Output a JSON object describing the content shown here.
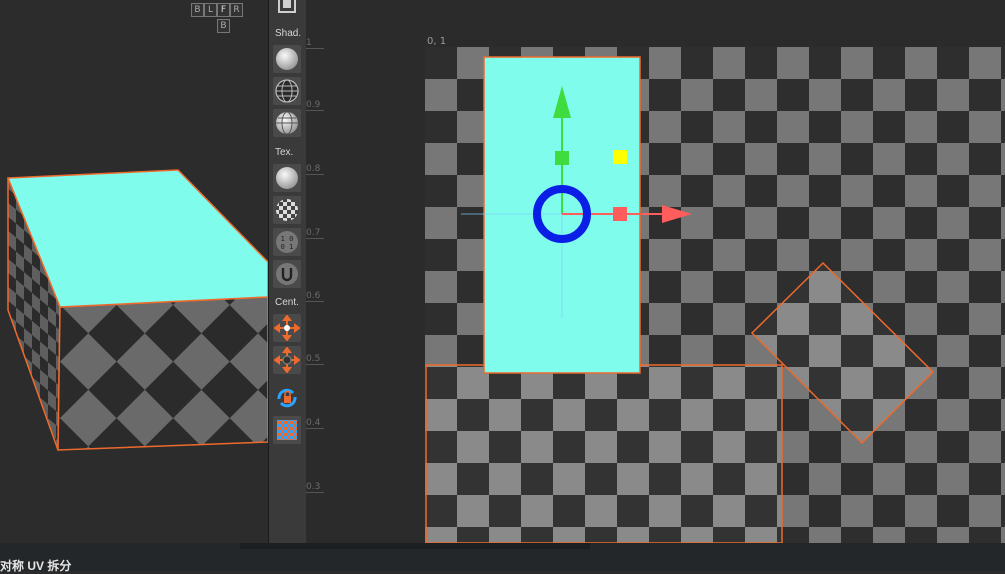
{
  "viewport": {
    "viewcube": [
      "B",
      "L",
      "F",
      "R",
      "B"
    ]
  },
  "toolbar": {
    "sections": [
      {
        "label": "Shad.",
        "buttons": [
          "shaded-sphere-icon",
          "wireframe-sphere-icon",
          "shaded-wire-sphere-icon"
        ]
      },
      {
        "label": "Tex.",
        "buttons": [
          "texture-off-icon",
          "checker-texture-icon",
          "binary-texture-icon",
          "custom-texture-icon"
        ]
      },
      {
        "label": "Cent.",
        "buttons": [
          "center-pivot-icon",
          "center-selection-icon",
          "lock-rotate-icon",
          "uv-grid-icon"
        ]
      }
    ]
  },
  "uv_editor": {
    "ruler": [
      "1",
      "0.9",
      "0.8",
      "0.7",
      "0.6",
      "0.5",
      "0.4",
      "0.3"
    ],
    "corner_label": "0, 1",
    "colors": {
      "selected_face": "#7ffcec",
      "border": "#ee6a2c",
      "checker_dark": "#2e2e2e",
      "checker_light": "#777777",
      "move_y": "#3fdc3f",
      "move_x": "#ff5c5c",
      "rotate_ring": "#0a1ee6",
      "scale_handle": "#ffff00"
    }
  },
  "status": {
    "title": "对称 UV 拆分"
  }
}
